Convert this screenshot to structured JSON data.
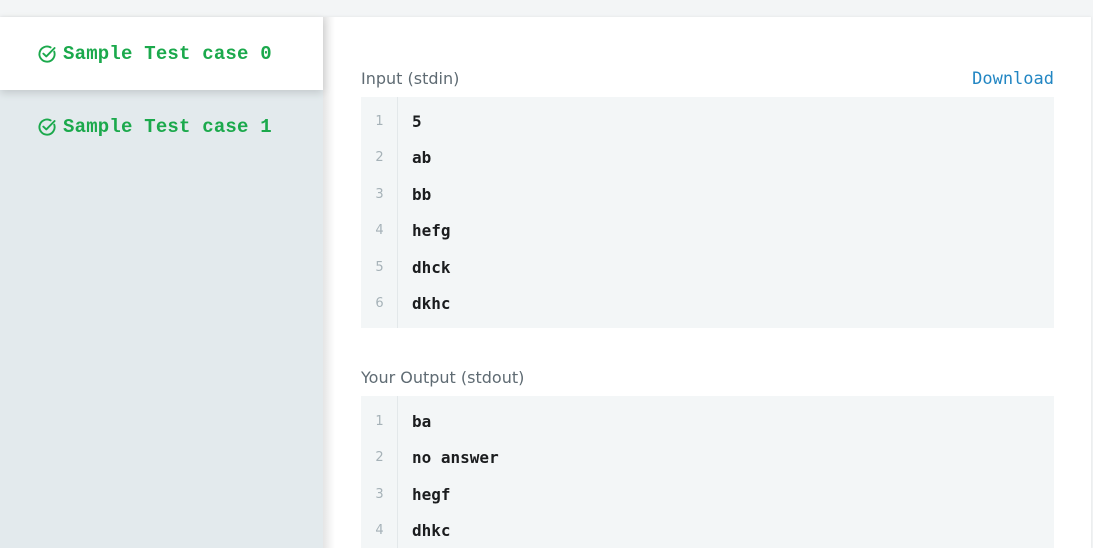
{
  "colors": {
    "accent_green": "#1ba94c",
    "link_blue": "#2286c3",
    "sidebar_bg": "#e3eaed",
    "code_bg": "#f3f6f7"
  },
  "tabs": [
    {
      "label": "Sample Test case 0",
      "icon": "check-circle-icon",
      "active": true
    },
    {
      "label": "Sample Test case 1",
      "icon": "check-circle-icon",
      "active": false
    }
  ],
  "input": {
    "title": "Input (stdin)",
    "download_label": "Download",
    "lines": [
      {
        "n": "1",
        "text": "5"
      },
      {
        "n": "2",
        "text": "ab"
      },
      {
        "n": "3",
        "text": "bb"
      },
      {
        "n": "4",
        "text": "hefg"
      },
      {
        "n": "5",
        "text": "dhck"
      },
      {
        "n": "6",
        "text": "dkhc"
      }
    ]
  },
  "output": {
    "title": "Your Output (stdout)",
    "lines": [
      {
        "n": "1",
        "text": "ba"
      },
      {
        "n": "2",
        "text": "no answer"
      },
      {
        "n": "3",
        "text": "hegf"
      },
      {
        "n": "4",
        "text": "dhkc"
      }
    ]
  }
}
